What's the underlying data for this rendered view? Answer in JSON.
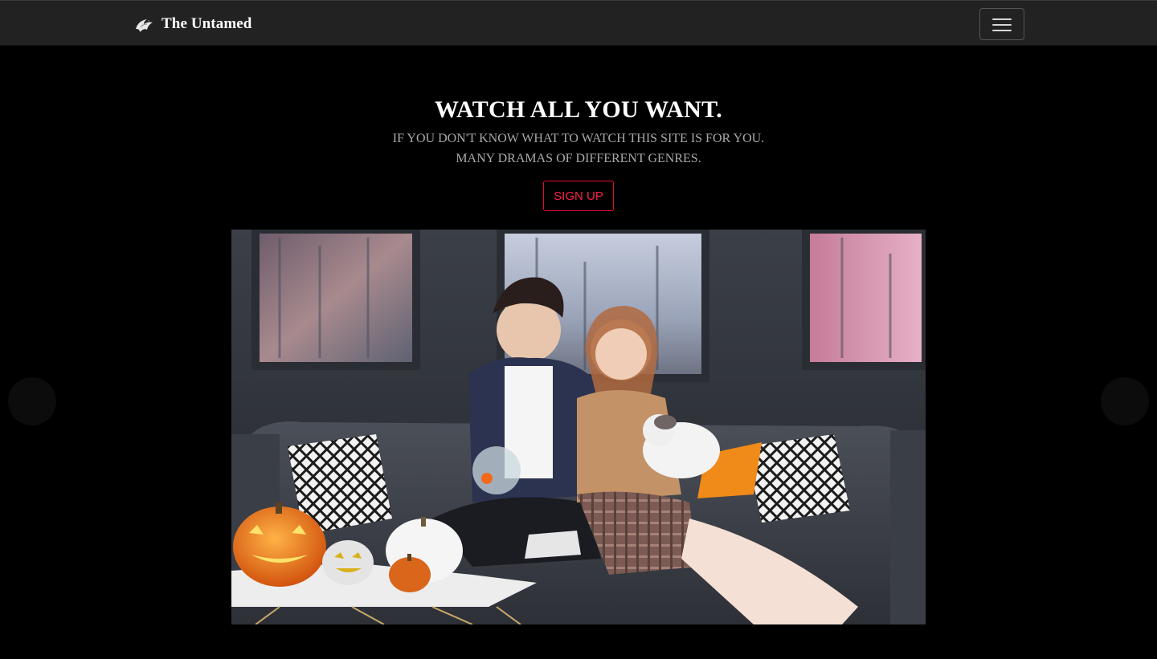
{
  "navbar": {
    "brand": "The Untamed",
    "logo_icon": "dragon-logo-icon",
    "menu_icon": "hamburger-menu-icon"
  },
  "hero": {
    "title": "WATCH ALL YOU WANT.",
    "subtitle_line1": "IF YOU DON'T KNOW WHAT TO WATCH THIS SITE IS FOR YOU.",
    "subtitle_line2": "MANY DRAMAS OF DIFFERENT GENRES.",
    "signup_label": "SIGN UP"
  },
  "carousel": {
    "prev_icon": "chevron-left-icon",
    "next_icon": "chevron-right-icon",
    "slide_description_icon": "drama-poster-image"
  },
  "colors": {
    "navbar_bg": "#222222",
    "page_bg": "#000000",
    "accent": "#ff1f4a",
    "subtitle": "#a9a9a9"
  }
}
